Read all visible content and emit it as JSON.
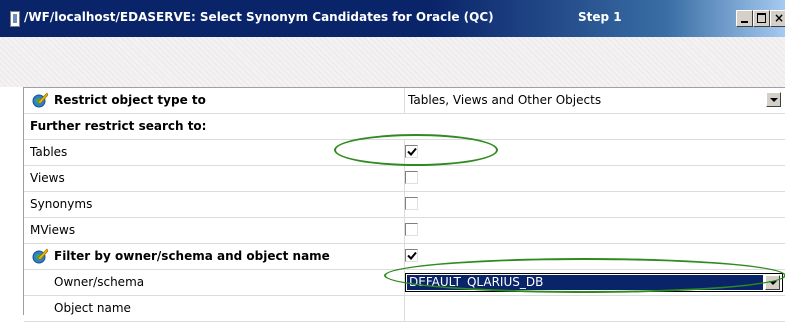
{
  "window": {
    "title": "/WF/localhost/EDASERVE: Select Synonym Candidates for Oracle (QC)",
    "step": "Step 1",
    "close_glyph": "×"
  },
  "grid": {
    "restrict_label": "Restrict object type to",
    "restrict_value": "Tables, Views and Other Objects",
    "further_label": "Further restrict search to:",
    "tables_label": "Tables",
    "tables_checked": true,
    "views_label": "Views",
    "views_checked": false,
    "synonyms_label": "Synonyms",
    "synonyms_checked": false,
    "mviews_label": "MViews",
    "mviews_checked": false,
    "filter_label": "Filter by owner/schema and object name",
    "filter_checked": true,
    "owner_label": "Owner/schema",
    "owner_value": "DEFAULT_QLARIUS_DB",
    "objname_label": "Object name",
    "objname_value": ""
  },
  "colors": {
    "highlight": "#2e8b1e",
    "titlebar": "#0a246a",
    "selection": "#0a246a"
  },
  "icons": [
    "window-icon",
    "globe-icon",
    "dropdown-arrow-icon",
    "check-icon"
  ]
}
